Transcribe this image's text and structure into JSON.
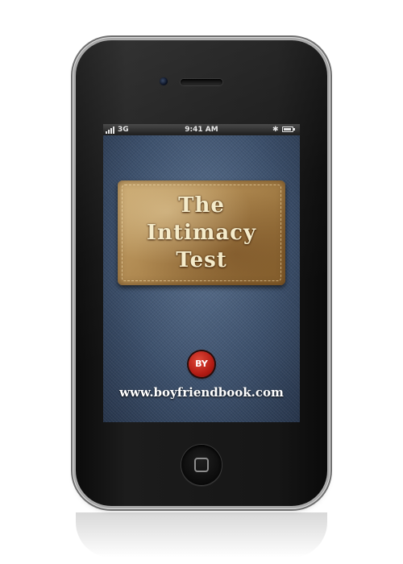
{
  "status_bar": {
    "network": "3G",
    "time": "9:41 AM",
    "bluetooth_icon": "bluetooth-icon",
    "battery_level": 0.85
  },
  "app": {
    "title_lines": [
      "The",
      "Intimacy",
      "Test"
    ],
    "by_label": "BY",
    "website": "www.boyfriendbook.com"
  },
  "colors": {
    "patch": "#b08a52",
    "badge": "#b31c14",
    "denim": "#3d516d"
  }
}
